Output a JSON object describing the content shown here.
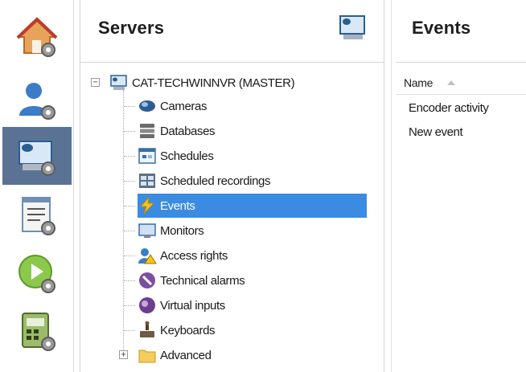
{
  "sidebar": {
    "items": [
      {
        "name": "home-settings",
        "icon": "house-gear-icon"
      },
      {
        "name": "users-settings",
        "icon": "user-gear-icon"
      },
      {
        "name": "servers-settings",
        "icon": "server-gear-icon",
        "active": true
      },
      {
        "name": "list-settings",
        "icon": "list-gear-icon"
      },
      {
        "name": "play-settings",
        "icon": "play-gear-icon"
      },
      {
        "name": "panel-settings",
        "icon": "panel-gear-icon"
      }
    ],
    "active_color": "#5a7394"
  },
  "servers_panel": {
    "title": "Servers",
    "root": {
      "label": "CAT-TECHWINNVR (MASTER)",
      "icon": "server-icon"
    },
    "items": [
      {
        "label": "Cameras",
        "icon": "camera-icon"
      },
      {
        "label": "Databases",
        "icon": "database-icon"
      },
      {
        "label": "Schedules",
        "icon": "schedule-icon"
      },
      {
        "label": "Scheduled recordings",
        "icon": "scheduled-recording-icon"
      },
      {
        "label": "Events",
        "icon": "lightning-icon",
        "selected": true
      },
      {
        "label": "Monitors",
        "icon": "monitor-icon"
      },
      {
        "label": "Access rights",
        "icon": "access-rights-icon"
      },
      {
        "label": "Technical alarms",
        "icon": "technical-alarm-icon"
      },
      {
        "label": "Virtual inputs",
        "icon": "virtual-input-icon"
      },
      {
        "label": "Keyboards",
        "icon": "keyboard-icon"
      },
      {
        "label": "Advanced",
        "icon": "folder-icon"
      }
    ],
    "selection_color": "#3b8be3"
  },
  "events_panel": {
    "title": "Events",
    "column_name": "Name",
    "rows": [
      "Encoder activity",
      "New event"
    ]
  }
}
